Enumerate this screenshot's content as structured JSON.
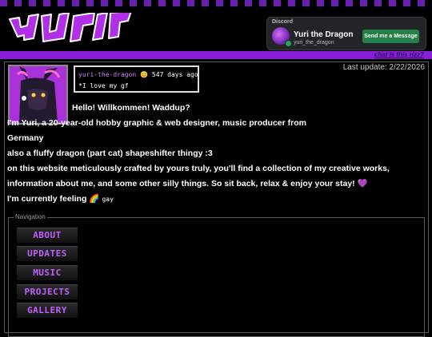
{
  "discord": {
    "label": "Discord",
    "name": "Yuri the Dragon",
    "handle": "yuri_the_dragon",
    "button": "Send me a Message"
  },
  "topbar": {
    "link": "chat is this rizz?"
  },
  "status": {
    "username": "yuri-the-dragon",
    "days": "547 days ago",
    "message": "*I love my gf"
  },
  "last_update": "Last update: 2/22/2026",
  "intro": {
    "greeting": "Hello! Willkommen! Waddup?",
    "line1": "I'm Yuri, a 20-year-old hobby graphic & web designer, music producer from",
    "line2": "Germany",
    "line3": "also a fluffy dragon (part cat) shapeshifter thingy :3",
    "line4": "on this website meticulously crafted by yours truly, you'll find a collection of my creative works,",
    "line5": "information about me, and some other silly things. So sit back, relax & enjoy your stay! 💜",
    "feeling_label": "I'm currently feeling",
    "feeling_value": "gay"
  },
  "navigation": {
    "legend": "Navigation",
    "items": [
      "ABOUT",
      "UPDATES",
      "MUSIC",
      "PROJECTS",
      "GALLERY"
    ]
  },
  "colors": {
    "accent": "#8a1fd8",
    "nav_text": "#c060ff",
    "discord_button": "#248046"
  },
  "icons": [
    "logo-yuri",
    "discord-avatar",
    "online-dot",
    "avatar",
    "smiley-emoji",
    "purple-heart-emoji",
    "rainbow-emoji"
  ]
}
